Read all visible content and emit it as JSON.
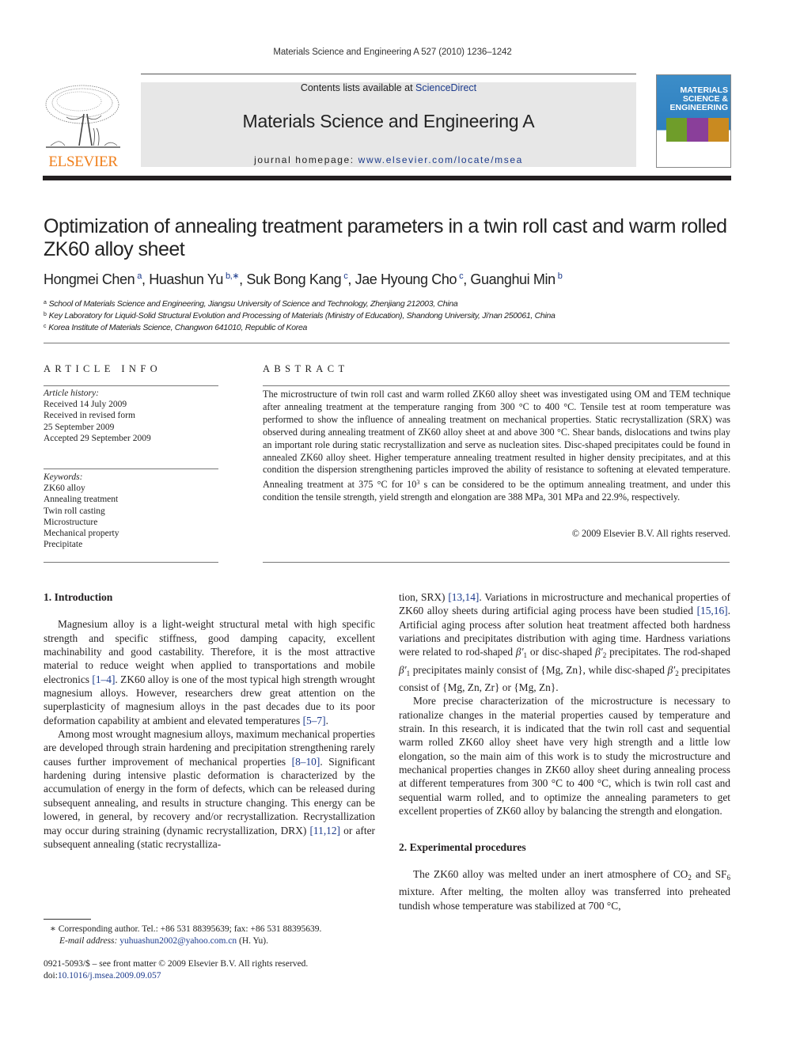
{
  "running_header": "Materials Science and Engineering A 527 (2010) 1236–1242",
  "publisher": {
    "wordmark": "ELSEVIER",
    "brand_color": "#f07f1b"
  },
  "banner": {
    "contents_prefix": "Contents lists available at ",
    "contents_link": "ScienceDirect",
    "journal_name": "Materials Science and Engineering A",
    "homepage_prefix": "journal homepage: ",
    "homepage_link": "www.elsevier.com/locate/msea"
  },
  "cover": {
    "line1": "MATERIALS",
    "line2": "SCIENCE &",
    "line3": "ENGINEERING"
  },
  "title": "Optimization of annealing treatment parameters in a twin roll cast and warm rolled ZK60 alloy sheet",
  "authors": [
    {
      "name": "Hongmei Chen",
      "aff": "a"
    },
    {
      "name": "Huashun Yu",
      "aff": "b,∗"
    },
    {
      "name": "Suk Bong Kang",
      "aff": "c"
    },
    {
      "name": "Jae Hyoung Cho",
      "aff": "c"
    },
    {
      "name": "Guanghui Min",
      "aff": "b"
    }
  ],
  "affiliations": [
    {
      "key": "a",
      "text": "School of Materials Science and Engineering, Jiangsu University of Science and Technology, Zhenjiang 212003, China"
    },
    {
      "key": "b",
      "text": "Key Laboratory for Liquid-Solid Structural Evolution and Processing of Materials (Ministry of Education), Shandong University, Ji'nan 250061, China"
    },
    {
      "key": "c",
      "text": "Korea Institute of Materials Science, Changwon 641010, Republic of Korea"
    }
  ],
  "article_info": {
    "heading": "ARTICLE INFO",
    "history_label": "Article history:",
    "history": [
      "Received 14 July 2009",
      "Received in revised form",
      "25 September 2009",
      "Accepted 29 September 2009"
    ],
    "keywords_label": "Keywords:",
    "keywords": [
      "ZK60 alloy",
      "Annealing treatment",
      "Twin roll casting",
      "Microstructure",
      "Mechanical property",
      "Precipitate"
    ]
  },
  "abstract": {
    "heading": "ABSTRACT",
    "text_a": "The microstructure of twin roll cast and warm rolled ZK60 alloy sheet was investigated using OM and TEM technique after annealing treatment at the temperature ranging from 300 °C to 400 °C. Tensile test at room temperature was performed to show the influence of annealing treatment on mechanical properties. Static recrystallization (SRX) was observed during annealing treatment of ZK60 alloy sheet at and above 300 °C. Shear bands, dislocations and twins play an important role during static recrystallization and serve as nucleation sites. Disc-shaped precipitates could be found in annealed ZK60 alloy sheet. Higher temperature annealing treatment resulted in higher density precipitates, and at this condition the dispersion strengthening particles improved the ability of resistance to softening at elevated temperature. Annealing treatment at 375 °C for 10",
    "text_sup": "3",
    "text_b": " s can be considered to be the optimum annealing treatment, and under this condition the tensile strength, yield strength and elongation are 388 MPa, 301 MPa and 22.9%, respectively.",
    "copyright": "© 2009 Elsevier B.V. All rights reserved."
  },
  "body": {
    "sec1_heading": "1.  Introduction",
    "p1_a": "Magnesium alloy is a light-weight structural metal with high specific strength and specific stiffness, good damping capacity, excellent machinability and good castability. Therefore, it is the most attractive material to reduce weight when applied to transportations and mobile electronics ",
    "ref_1_4": "[1–4]",
    "p1_b": ". ZK60 alloy is one of the most typical high strength wrought magnesium alloys. However, researchers drew great attention on the superplasticity of magnesium alloys in the past decades due to its poor deformation capability at ambient and elevated temperatures ",
    "ref_5_7": "[5–7]",
    "p1_c": ".",
    "p2_a": "Among most wrought magnesium alloys, maximum mechanical properties are developed through strain hardening and precipitation strengthening rarely causes further improvement of mechanical properties ",
    "ref_8_10": "[8–10]",
    "p2_b": ". Significant hardening during intensive plastic deformation is characterized by the accumulation of energy in the form of defects, which can be released during subsequent annealing, and results in structure changing. This energy can be lowered, in general, by recovery and/or recrystallization. Recrystallization may occur during straining (dynamic recrystallization, DRX) ",
    "ref_11_12": "[11,12]",
    "p2_c": " or after subsequent annealing (static recrystalliza-",
    "p2_d": "tion, SRX) ",
    "ref_13_14": "[13,14]",
    "p2_e": ". Variations in microstructure and mechanical properties of ZK60 alloy sheets during artificial aging process have been studied ",
    "ref_15_16": "[15,16]",
    "p2_f": ". Artificial aging process after solution heat treatment affected both hardness variations and precipitates distribution with aging time. Hardness variations were related to rod-shaped ",
    "beta1": "β′",
    "sub1": "1",
    "p2_g": " or disc-shaped ",
    "sub2": "2",
    "p2_h": " precipitates. The rod-shaped ",
    "p2_i": " precipitates mainly consist of {Mg, Zn}, while disc-shaped ",
    "p2_j": " precipitates consist of {Mg, Zn, Zr} or {Mg, Zn}.",
    "p3": "More precise characterization of the microstructure is necessary to rationalize changes in the material properties caused by temperature and strain. In this research, it is indicated that the twin roll cast and sequential warm rolled ZK60 alloy sheet have very high strength and a little low elongation, so the main aim of this work is to study the microstructure and mechanical properties changes in ZK60 alloy sheet during annealing process at different temperatures from 300 °C to 400 °C, which is twin roll cast and sequential warm rolled, and to optimize the annealing parameters to get excellent properties of ZK60 alloy by balancing the strength and elongation.",
    "sec2_heading": "2.  Experimental procedures",
    "p4_a": "The ZK60 alloy was melted under an inert atmosphere of CO",
    "p4_sub_co2": "2",
    "p4_b": " and SF",
    "p4_sub_sf6": "6",
    "p4_c": " mixture. After melting, the molten alloy was transferred into preheated tundish whose temperature was stabilized at 700 °C,"
  },
  "footnote": {
    "star": "∗",
    "corresponding": " Corresponding author. Tel.: +86 531 88395639; fax: +86 531 88395639.",
    "email_label": "E-mail address: ",
    "email": "yuhuashun2002@yahoo.com.cn",
    "email_suffix": " (H. Yu)."
  },
  "front_matter": {
    "issn_line": "0921-5093/$ – see front matter © 2009 Elsevier B.V. All rights reserved.",
    "doi_label": "doi:",
    "doi": "10.1016/j.msea.2009.09.057"
  }
}
